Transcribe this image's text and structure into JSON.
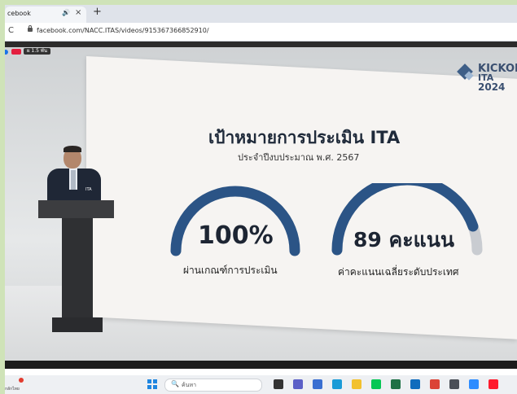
{
  "browser": {
    "tab_title": "cebook",
    "tab_audio": "🔊",
    "tab_close": "×",
    "new_tab": "+",
    "reload": "C",
    "url": "facebook.com/NACC.ITAS/videos/915367366852910/"
  },
  "video": {
    "live_label": "ผ 1.5 พัน",
    "logo": {
      "line1": "KICKOF",
      "line2": "ITA",
      "line3": "2024"
    },
    "slide": {
      "title": "เป้าหมายการประเมิน ITA",
      "subtitle": "ประจำปีงบประมาณ พ.ศ. 2567",
      "gauges": [
        {
          "value_text": "100%",
          "label": "ผ่านเกณฑ์การประเมิน",
          "fill_fraction": 1.0,
          "color": "#2b5486"
        },
        {
          "value_text": "89 คะแนน",
          "label": "ค่าคะแนนเฉลี่ยระดับประเทศ",
          "fill_fraction": 0.89,
          "color": "#2b5486"
        }
      ],
      "track_color": "#c9ccd1"
    },
    "speaker_badge": "ITA"
  },
  "taskbar": {
    "search_placeholder": "ค้นหา",
    "search_icon": "🔍",
    "widget_text": "กลักไทย",
    "icons": [
      {
        "name": "task-view-icon",
        "color": "#333333"
      },
      {
        "name": "chat-icon",
        "color": "#5b5fc7"
      },
      {
        "name": "photos-icon",
        "color": "#3a6fd1"
      },
      {
        "name": "edge-icon",
        "color": "#1a9bd7"
      },
      {
        "name": "file-explorer-icon",
        "color": "#f2c12e"
      },
      {
        "name": "line-icon",
        "color": "#06c755"
      },
      {
        "name": "excel-icon",
        "color": "#1e7145"
      },
      {
        "name": "outlook-icon",
        "color": "#0f6cbd"
      },
      {
        "name": "chrome-icon",
        "color": "#db4437"
      },
      {
        "name": "calculator-icon",
        "color": "#4a4f57"
      },
      {
        "name": "zoom-icon",
        "color": "#2d8cff"
      },
      {
        "name": "opera-icon",
        "color": "#ff1b2d"
      }
    ]
  }
}
